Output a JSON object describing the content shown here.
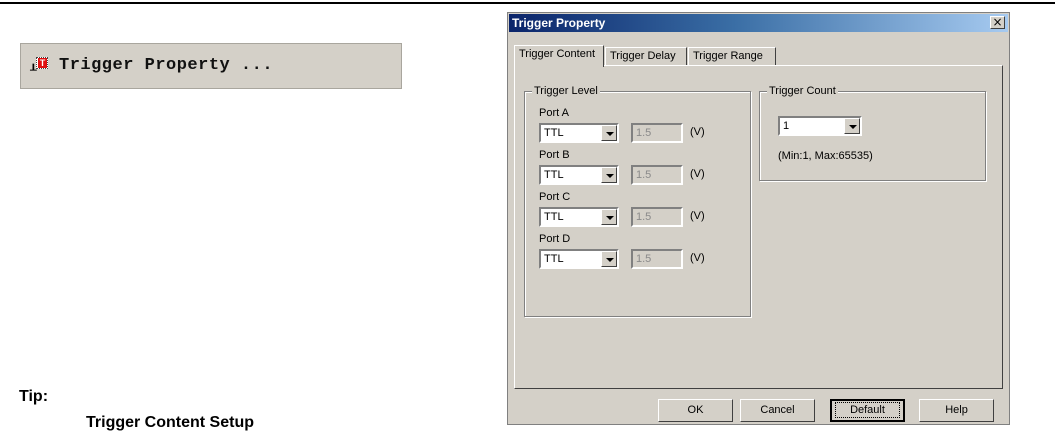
{
  "menu": {
    "label": "Trigger Property ..."
  },
  "tip": {
    "heading": "Tip:",
    "subheading": "Trigger Content Setup"
  },
  "dialog": {
    "title": "Trigger Property",
    "close_glyph": "×",
    "tabs": [
      {
        "label": "Trigger Content",
        "active": true
      },
      {
        "label": "Trigger Delay",
        "active": false
      },
      {
        "label": "Trigger Range",
        "active": false
      }
    ],
    "trigger_level": {
      "legend": "Trigger Level",
      "ports": [
        {
          "label": "Port A",
          "mode": "TTL",
          "voltage": "1.5",
          "unit": "(V)"
        },
        {
          "label": "Port B",
          "mode": "TTL",
          "voltage": "1.5",
          "unit": "(V)"
        },
        {
          "label": "Port C",
          "mode": "TTL",
          "voltage": "1.5",
          "unit": "(V)"
        },
        {
          "label": "Port D",
          "mode": "TTL",
          "voltage": "1.5",
          "unit": "(V)"
        }
      ]
    },
    "trigger_count": {
      "legend": "Trigger Count",
      "value": "1",
      "range_note": "(Min:1, Max:65535)"
    },
    "buttons": {
      "ok": "OK",
      "cancel": "Cancel",
      "default": "Default",
      "help": "Help"
    }
  },
  "icons": {
    "pin": "pin-icon",
    "trigger": "trigger-t-icon",
    "close": "close-icon",
    "dropdown": "chevron-down-icon"
  }
}
